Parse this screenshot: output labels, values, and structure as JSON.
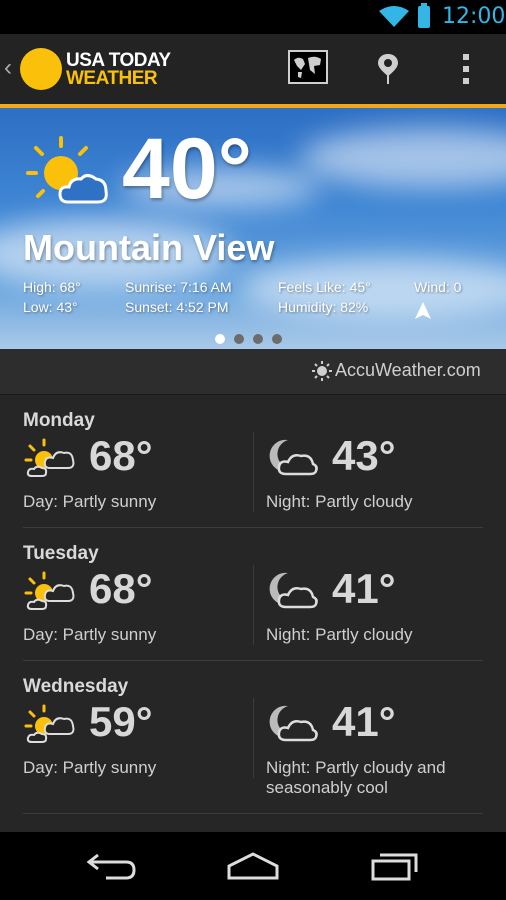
{
  "status": {
    "time": "12:00"
  },
  "appbar": {
    "logo_line1": "USA TODAY",
    "logo_line2": "WEATHER"
  },
  "current": {
    "temp": "40°",
    "city": "Mountain View",
    "high": "High: 68°",
    "low": "Low: 43°",
    "sunrise": "Sunrise: 7:16 AM",
    "sunset": "Sunset: 4:52 PM",
    "feels_like": "Feels Like: 45°",
    "humidity": "Humidity: 82%",
    "wind": "Wind: 0"
  },
  "attribution": "AccuWeather.com",
  "forecast": [
    {
      "day": "Monday",
      "day_temp": "68°",
      "day_text": "Day: Partly sunny",
      "night_temp": "43°",
      "night_text": "Night: Partly cloudy"
    },
    {
      "day": "Tuesday",
      "day_temp": "68°",
      "day_text": "Day: Partly sunny",
      "night_temp": "41°",
      "night_text": "Night: Partly cloudy"
    },
    {
      "day": "Wednesday",
      "day_temp": "59°",
      "day_text": "Day: Partly sunny",
      "night_temp": "41°",
      "night_text": "Night: Partly cloudy and seasonably cool"
    }
  ],
  "colors": {
    "accent": "#f2a71b",
    "status_blue": "#33b5e5",
    "sun": "#fbc10a"
  }
}
